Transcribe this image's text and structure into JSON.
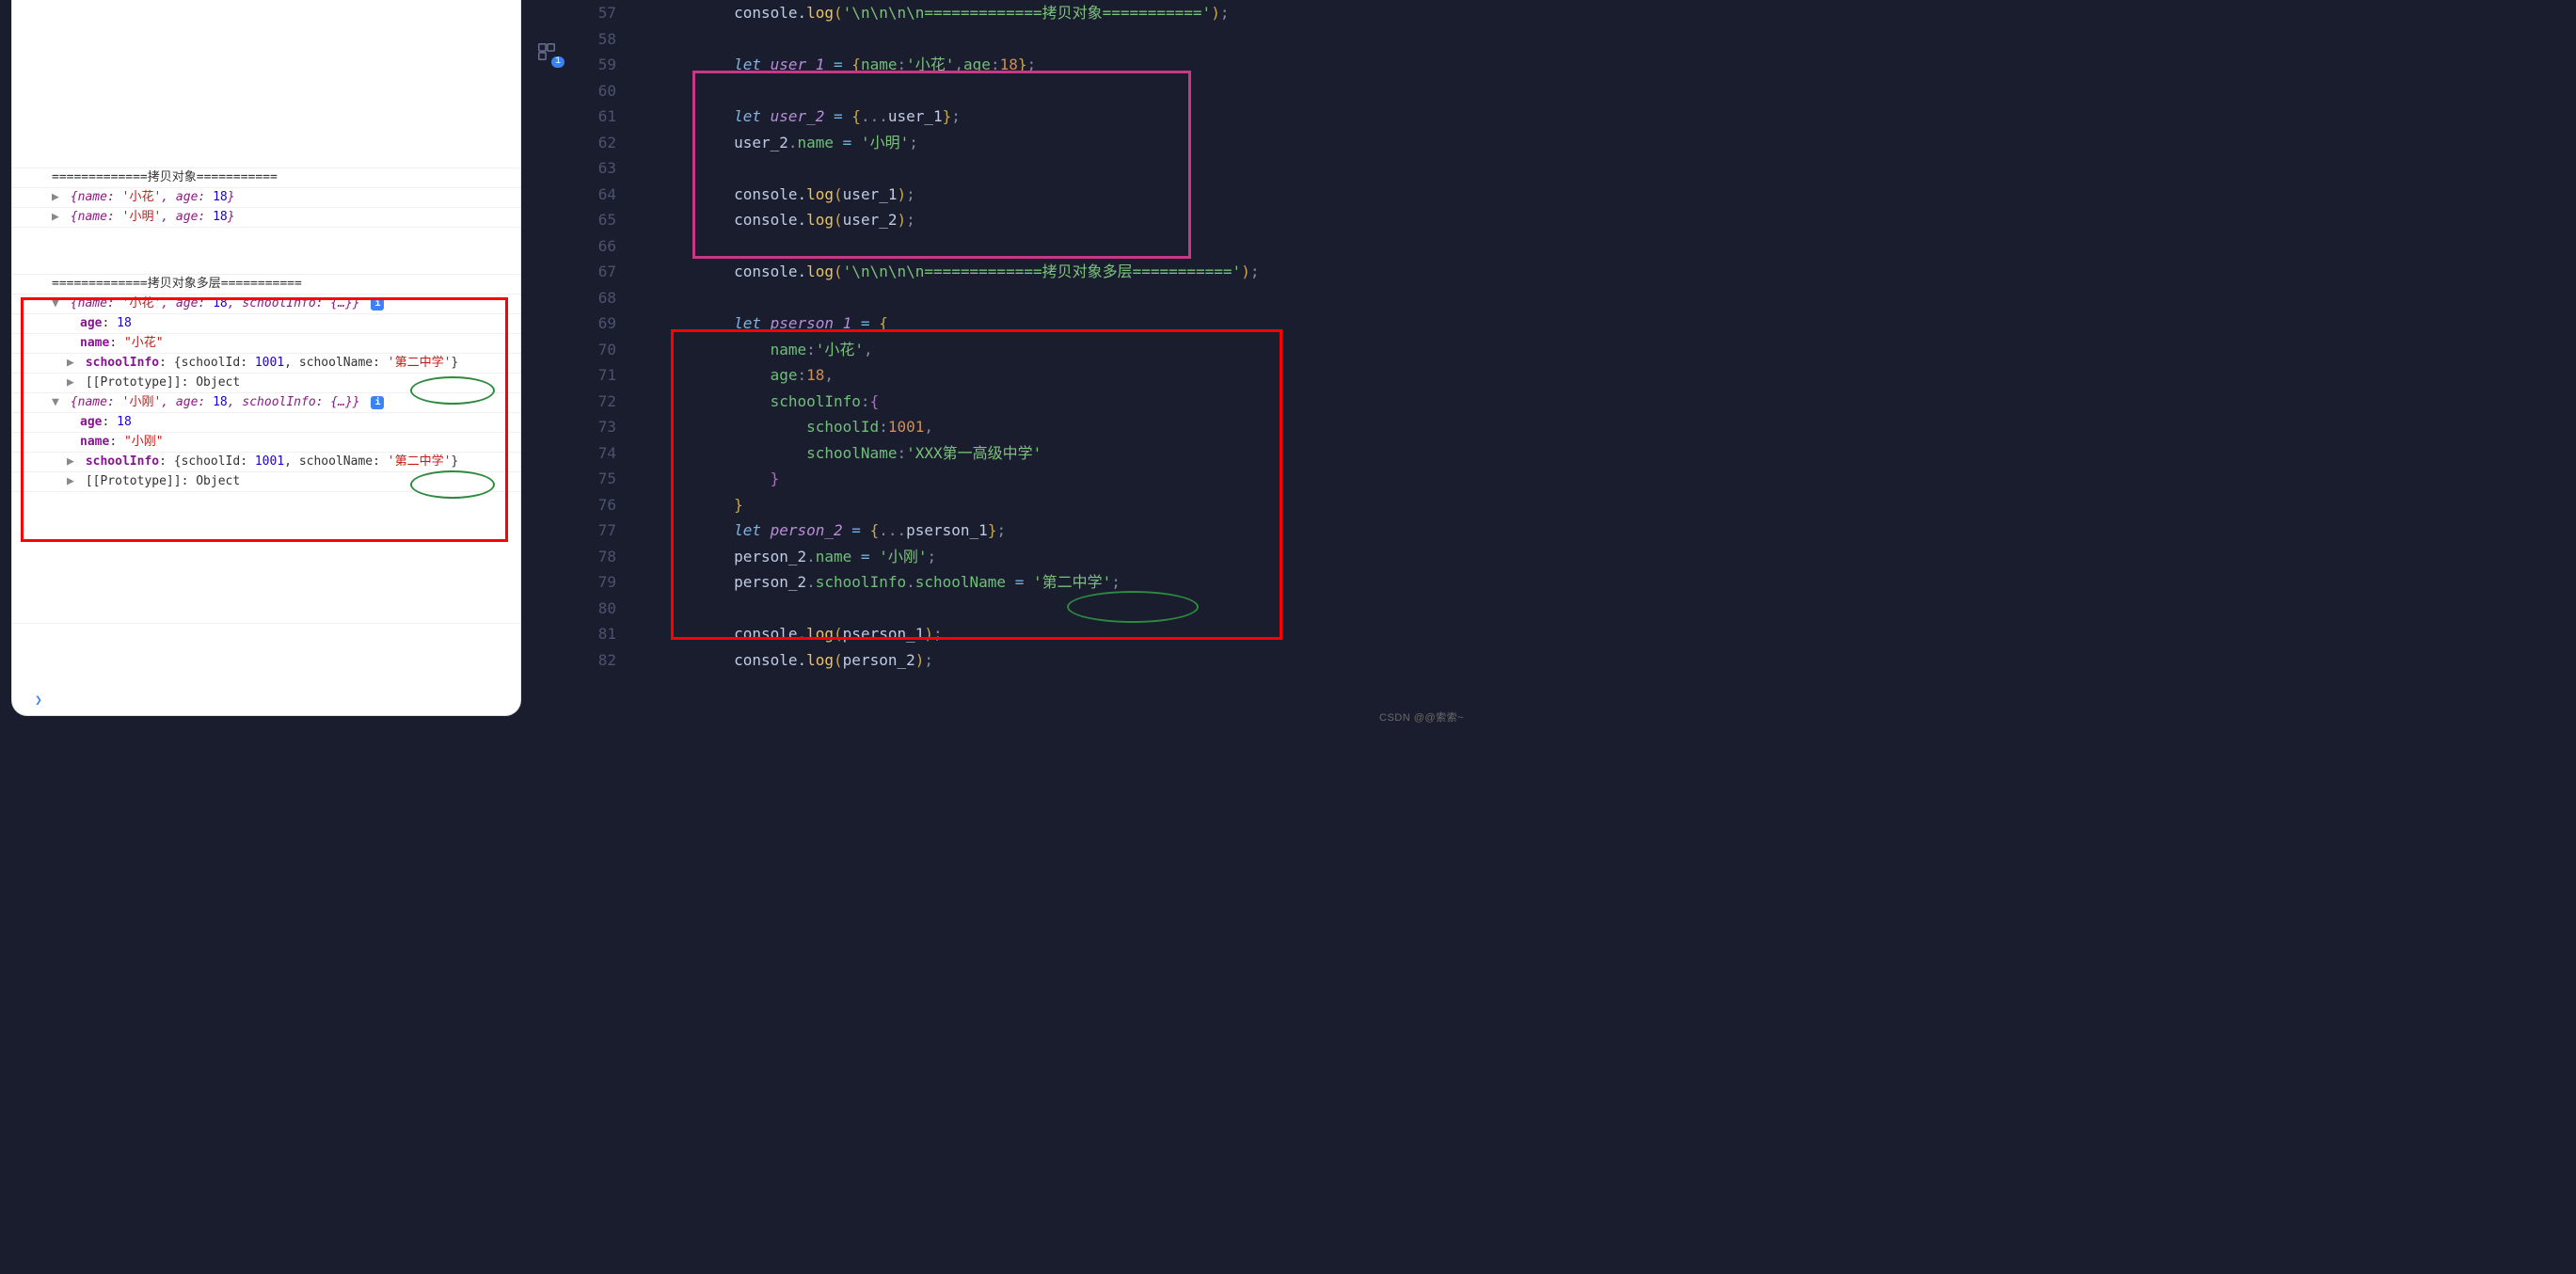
{
  "console": {
    "header_copy_obj": "=============拷贝对象===========",
    "obj1_summary_pre": "{name: ",
    "obj1_name": "'小花'",
    "obj1_age_lbl": ", age: ",
    "obj1_age": "18",
    "obj1_tail": "}",
    "obj2_name": "'小明'",
    "header_copy_deep": "=============拷贝对象多层===========",
    "exp_summary_tail": ", schoolInfo: {…}}",
    "age_lbl": "age",
    "age_val": "18",
    "name_lbl": "name",
    "exp1_name": "\"小花\"",
    "exp2_name": "\"小刚\"",
    "school_lbl": "schoolInfo",
    "school_val_pre": "{schoolId: ",
    "school_id": "1001",
    "school_val_mid": ", schoolName: ",
    "school_name": "'第二中学'",
    "school_val_end": "}",
    "proto_lbl": "[[Prototype]]",
    "proto_val": "Object"
  },
  "strip_badge": "1",
  "gutter": [
    "57",
    "58",
    "59",
    "60",
    "61",
    "62",
    "63",
    "64",
    "65",
    "66",
    "67",
    "68",
    "69",
    "70",
    "71",
    "72",
    "73",
    "74",
    "75",
    "76",
    "77",
    "78",
    "79",
    "80",
    "81",
    "82"
  ],
  "code": {
    "l57": {
      "pre": "        console.",
      "fn": "log",
      "open": "(",
      "str": "'\\n\\n\\n\\n=============拷贝对象==========='",
      "close": ")",
      "semi": ";"
    },
    "l59_let": "let ",
    "l59_var": "user_1",
    "l59_eq": " = ",
    "l59_open": "{",
    "l59_k1": "name",
    "l59_c": ":",
    "l59_v1": "'小花'",
    "l59_comma": ",",
    "l59_k2": "age",
    "l59_v2": "18",
    "l59_close": "}",
    "l59_semi": ";",
    "l61_let": "let ",
    "l61_var": "user_2",
    "l61_eq": " = ",
    "l61_open": "{",
    "l61_spread": "...",
    "l61_src": "user_1",
    "l61_close": "}",
    "l61_semi": ";",
    "l62_obj": "user_2",
    "l62_dot": ".",
    "l62_prop": "name",
    "l62_eq": " = ",
    "l62_val": "'小明'",
    "l62_semi": ";",
    "l64_pre": "        console.",
    "l64_fn": "log",
    "l64_open": "(",
    "l64_arg": "user_1",
    "l64_close": ")",
    "l64_semi": ";",
    "l65_arg": "user_2",
    "l67_str": "'\\n\\n\\n\\n=============拷贝对象多层==========='",
    "l69_let": "let ",
    "l69_var": "pserson_1",
    "l69_eq": " = ",
    "l69_open": "{",
    "l70_k": "name",
    "l70_v": "'小花'",
    "l70_c": ",",
    "l71_k": "age",
    "l71_v": "18",
    "l71_c": ",",
    "l72_k": "schoolInfo",
    "l72_open": "{",
    "l73_k": "schoolId",
    "l73_v": "1001",
    "l73_c": ",",
    "l74_k": "schoolName",
    "l74_v": "'XXX第一高级中学'",
    "l75_close": "}",
    "l76_close": "}",
    "l77_let": "let ",
    "l77_var": "person_2",
    "l77_eq": " = ",
    "l77_open": "{",
    "l77_spread": "...",
    "l77_src": "pserson_1",
    "l77_close": "}",
    "l77_semi": ";",
    "l78_obj": "person_2",
    "l78_prop": "name",
    "l78_val": "'小刚'",
    "l78_semi": ";",
    "l79_obj": "person_2",
    "l79_p1": "schoolInfo",
    "l79_p2": "schoolName",
    "l79_val": "'第二中学'",
    "l79_semi": ";",
    "l81_arg": "pserson_1",
    "l82_arg": "person_2"
  },
  "watermark": "CSDN @@索索~"
}
